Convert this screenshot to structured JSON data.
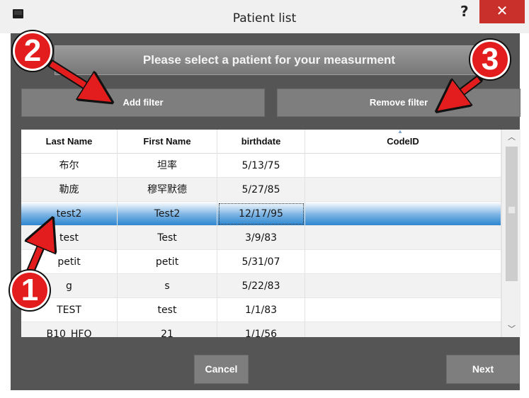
{
  "window": {
    "title": "Patient list",
    "help_symbol": "?",
    "close_symbol": "✕"
  },
  "banner": {
    "text": "Please select a patient for your measurment"
  },
  "filters": {
    "add_label": "Add filter",
    "remove_label": "Remove filter"
  },
  "table": {
    "columns": [
      "Last Name",
      "First Name",
      "birthdate",
      "CodeID"
    ],
    "rows": [
      [
        "布尔",
        "坦率",
        "5/13/75",
        ""
      ],
      [
        "勒庞",
        "穆罕默德",
        "5/27/85",
        ""
      ],
      [
        "test2",
        "Test2",
        "12/17/95",
        ""
      ],
      [
        "test",
        "Test",
        "3/9/83",
        ""
      ],
      [
        "petit",
        "petit",
        "5/31/07",
        ""
      ],
      [
        "g",
        "s",
        "5/22/83",
        ""
      ],
      [
        "TEST",
        "test",
        "1/1/83",
        ""
      ],
      [
        "B10_HFO",
        "21",
        "1/1/56",
        ""
      ]
    ],
    "selected_row_index": 2
  },
  "footer": {
    "cancel_label": "Cancel",
    "next_label": "Next"
  },
  "annotations": [
    "1",
    "2",
    "3"
  ],
  "colors": {
    "dialog_bg": "#555555",
    "marker_red": "#e31d1d",
    "selection_blue": "#2e86d1",
    "close_red": "#c9302c"
  }
}
